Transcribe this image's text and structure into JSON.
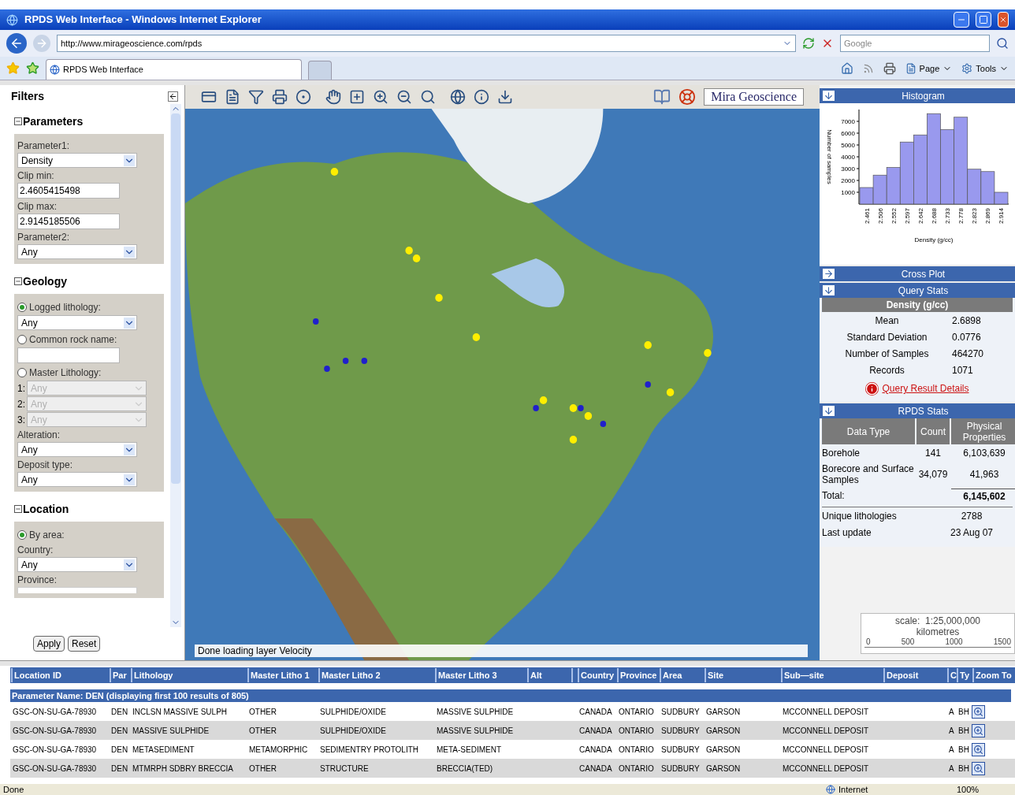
{
  "window": {
    "title": "RPDS Web Interface - Windows Internet Explorer"
  },
  "address_bar": {
    "url": "http://www.mirageoscience.com/rpds",
    "search_placeholder": "Google"
  },
  "tabs": [
    {
      "label": "RPDS Web Interface",
      "selected": true
    }
  ],
  "command_bar": {
    "items": [
      "Page",
      "Tools"
    ]
  },
  "filters": {
    "title": "Filters",
    "sections": [
      {
        "title": "Parameters",
        "expanded": true,
        "items": [
          {
            "kind": "select",
            "label": "Parameter1:",
            "value": "Density",
            "disabled": false
          },
          {
            "kind": "input",
            "label": "Clip min:",
            "value": "2.4605415498"
          },
          {
            "kind": "input",
            "label": "Clip max:",
            "value": "2.9145185506"
          },
          {
            "kind": "select",
            "label": "Parameter2:",
            "value": "Any",
            "disabled": false
          }
        ]
      },
      {
        "title": "Geology",
        "expanded": true,
        "items": [
          {
            "kind": "radio",
            "label": "Logged lithology:",
            "selected": true
          },
          {
            "kind": "select",
            "value": "Any",
            "disabled": false
          },
          {
            "kind": "radio",
            "label": "Common rock name:",
            "selected": false
          },
          {
            "kind": "input"
          },
          {
            "kind": "radio",
            "label": "Master Lithology:",
            "selected": false
          },
          {
            "kind": "select",
            "prefix": "1:",
            "value": "Any",
            "disabled": true
          },
          {
            "kind": "select",
            "prefix": "2:",
            "value": "Any",
            "disabled": true
          },
          {
            "kind": "select",
            "prefix": "3:",
            "value": "Any",
            "disabled": true
          },
          {
            "kind": "select",
            "label": "Alteration:",
            "value": "Any",
            "disabled": false
          },
          {
            "kind": "select",
            "label": "Deposit type:",
            "value": "Any",
            "disabled": false
          }
        ]
      },
      {
        "title": "Location",
        "expanded": true,
        "items": [
          {
            "kind": "radio",
            "label": "By area:",
            "selected": true
          },
          {
            "kind": "select",
            "label": "Country:",
            "value": "Any",
            "disabled": false
          },
          {
            "kind": "select",
            "label": "Province:",
            "disabled": false
          }
        ]
      }
    ],
    "buttons": [
      "Apply",
      "Reset"
    ]
  },
  "map": {
    "brand": "Mira Geoscience",
    "status": "Done loading layer Velocity",
    "scale": {
      "label": "scale:  1:25,000,000",
      "unit": "kilometres",
      "ticks": [
        "0",
        "500",
        "1000",
        "1500"
      ]
    }
  },
  "panels": [
    {
      "kind": "histogram",
      "title": "Histogram",
      "expanded": true,
      "chart_data": {
        "type": "bar",
        "xlabel": "Density (g/cc)",
        "ylabel": "Number of samples",
        "categories": [
          "2.461",
          "2.506",
          "2.552",
          "2.597",
          "2.642",
          "2.688",
          "2.733",
          "2.778",
          "2.823",
          "2.869",
          "2.914"
        ],
        "values": [
          1400,
          2450,
          3100,
          5250,
          5850,
          7650,
          6300,
          7350,
          2950,
          2750,
          1000
        ],
        "ylim": [
          0,
          8000
        ],
        "yticks": [
          {
            "value": 1000,
            "label": "1000"
          },
          {
            "value": 2000,
            "label": "2000"
          },
          {
            "value": 3000,
            "label": "3000"
          },
          {
            "value": 4000,
            "label": "4000"
          },
          {
            "value": 5000,
            "label": "5000"
          },
          {
            "value": 6000,
            "label": "6000"
          },
          {
            "value": 7000,
            "label": "7000"
          }
        ]
      }
    },
    {
      "title": "Cross Plot",
      "expanded": false
    },
    {
      "kind": "stats",
      "title": "Query Stats",
      "expanded": true,
      "subtitle": "Density (g/cc)",
      "rows": [
        {
          "label": "Mean",
          "value": "2.6898"
        },
        {
          "label": "Standard Deviation",
          "value": "0.0776"
        },
        {
          "label": "Number of Samples",
          "value": "464270"
        },
        {
          "label": "Records",
          "value": "1071"
        }
      ],
      "link": "Query Result Details"
    },
    {
      "kind": "rpds",
      "title": "RPDS Stats",
      "expanded": true,
      "columns": [
        "Data Type",
        "Count",
        "Physical Properties"
      ],
      "rows": [
        {
          "type": "Borehole",
          "count": "141",
          "properties": "6,103,639"
        },
        {
          "type": "Borecore and Surface Samples",
          "count": "34,079",
          "properties": "41,963"
        }
      ],
      "total_label": "Total:",
      "total": "6,145,602",
      "extra": [
        {
          "label": "Unique lithologies",
          "value": "2788"
        },
        {
          "label": "Last update",
          "value": "23 Aug 07"
        }
      ]
    }
  ],
  "results": {
    "columns": [
      "Location ID",
      "Par",
      "Lithology",
      "Master Litho 1",
      "Master Litho 2",
      "Master Litho 3",
      "Alt",
      "",
      "Country",
      "Province",
      "Area",
      "Site",
      "Sub—site",
      "Deposit",
      "C",
      "Ty",
      "Zoom To"
    ],
    "caption": "Parameter Name: DEN (displaying first 100 results of 805)",
    "rows": [
      [
        "GSC-ON-SU-GA-78930",
        "DEN",
        "INCLSN MASSIVE SULPH",
        "OTHER",
        "SULPHIDE/OXIDE",
        "MASSIVE SULPHIDE",
        "",
        "",
        "CANADA",
        "ONTARIO",
        "SUDBURY",
        "GARSON",
        "MCCONNELL DEPOSIT",
        "",
        "A",
        "BH"
      ],
      [
        "GSC-ON-SU-GA-78930",
        "DEN",
        "MASSIVE SULPHIDE",
        "OTHER",
        "SULPHIDE/OXIDE",
        "MASSIVE SULPHIDE",
        "",
        "",
        "CANADA",
        "ONTARIO",
        "SUDBURY",
        "GARSON",
        "MCCONNELL DEPOSIT",
        "",
        "A",
        "BH"
      ],
      [
        "GSC-ON-SU-GA-78930",
        "DEN",
        "METASEDIMENT",
        "METAMORPHIC",
        "SEDIMENTRY PROTOLITH",
        "META-SEDIMENT",
        "",
        "",
        "CANADA",
        "ONTARIO",
        "SUDBURY",
        "GARSON",
        "MCCONNELL DEPOSIT",
        "",
        "A",
        "BH"
      ],
      [
        "GSC-ON-SU-GA-78930",
        "DEN",
        "MTMRPH SDBRY BRECCIA",
        "OTHER",
        "STRUCTURE",
        "BRECCIA(TED)",
        "",
        "",
        "CANADA",
        "ONTARIO",
        "SUDBURY",
        "GARSON",
        "MCCONNELL DEPOSIT",
        "",
        "A",
        "BH"
      ]
    ]
  },
  "status_bar": {
    "text": "Done",
    "zone": "Internet",
    "zoom": "100%"
  }
}
